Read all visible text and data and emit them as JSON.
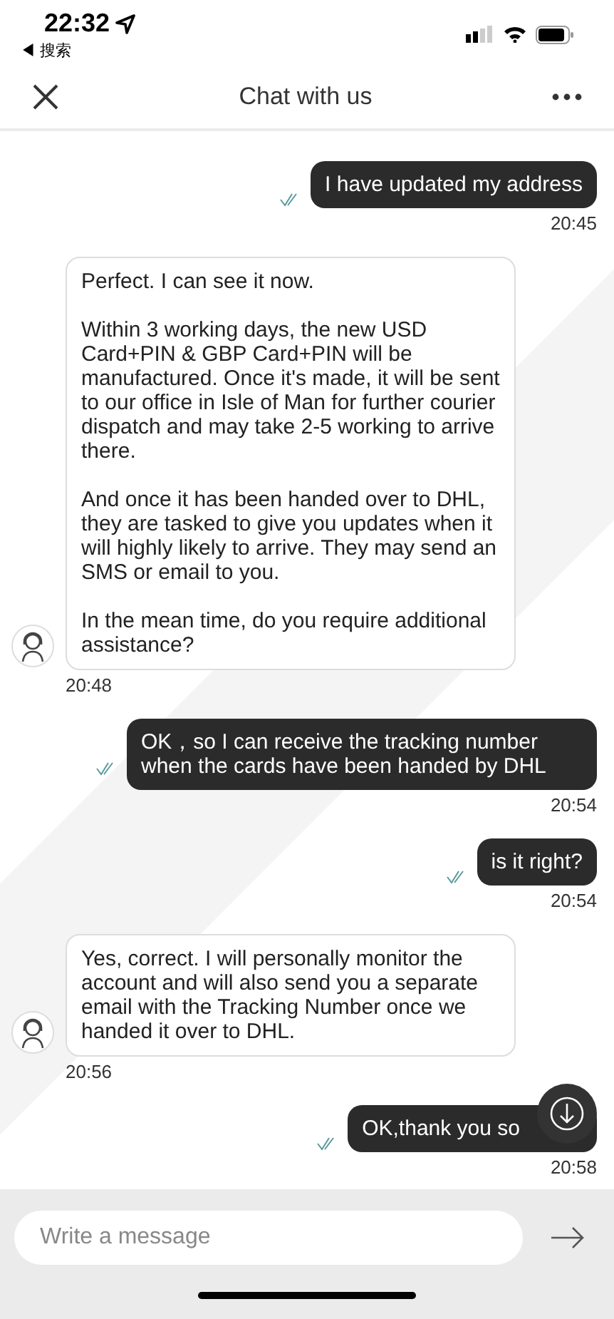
{
  "status_bar": {
    "time": "22:32",
    "back_label": "◀ 搜索"
  },
  "header": {
    "title": "Chat with us"
  },
  "messages": [
    {
      "kind": "sent",
      "paragraphs": [
        "I have updated my  address"
      ],
      "time": "20:45",
      "read": true
    },
    {
      "kind": "received",
      "paragraphs": [
        "Perfect. I can see it now.",
        "Within 3 working days, the new USD Card+PIN & GBP Card+PIN will be manufactured. Once it's made, it will be sent to our office in Isle of Man for further courier dispatch and may take 2-5 working to arrive there.",
        "And once it has been handed over to DHL, they are tasked to give you updates when it will highly likely to arrive. They may send an SMS or email to you.",
        "   In the mean time, do you require additional assistance?"
      ],
      "time": "20:48"
    },
    {
      "kind": "sent",
      "paragraphs": [
        "OK，so I can receive the tracking number when the cards have been handed by DHL"
      ],
      "time": "20:54",
      "read": true
    },
    {
      "kind": "sent",
      "paragraphs": [
        "is it right?"
      ],
      "time": "20:54",
      "read": true
    },
    {
      "kind": "received",
      "paragraphs": [
        "Yes, correct. I will personally monitor the account and will also send you a separate email with the Tracking Number once we handed it over to DHL."
      ],
      "time": "20:56"
    },
    {
      "kind": "sent",
      "paragraphs": [
        "OK,thank you so"
      ],
      "time": "20:58",
      "read": true
    }
  ],
  "composer": {
    "placeholder": "Write a message"
  }
}
